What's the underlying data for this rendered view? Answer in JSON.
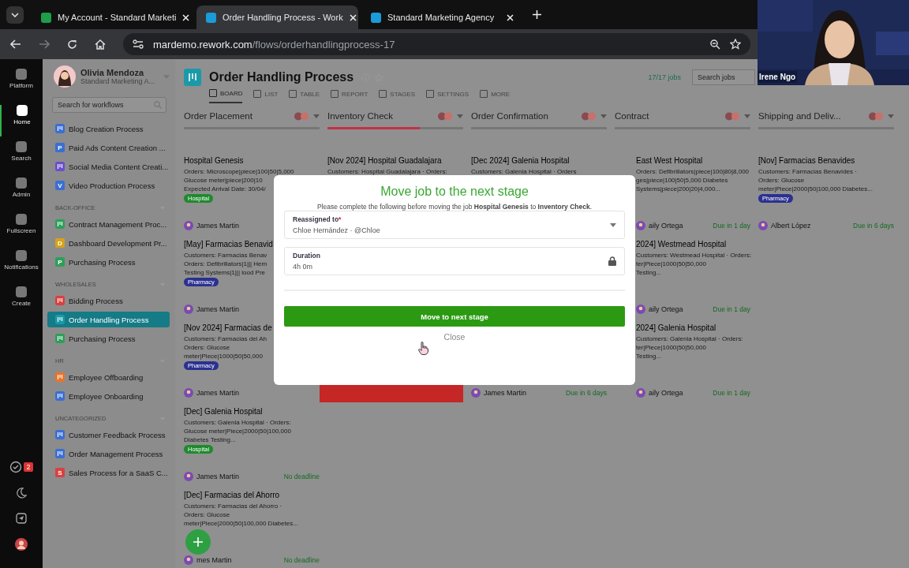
{
  "browser": {
    "tabs": [
      {
        "title": "My Account - Standard Marketi",
        "selected": false
      },
      {
        "title": "Order Handling Process - Work",
        "selected": true
      },
      {
        "title": "Standard Marketing Agency",
        "selected": false
      }
    ],
    "url": {
      "domain": "mardemo.rework.com",
      "path": "/flows/orderhandlingprocess-17"
    }
  },
  "webcam": {
    "name": "Irene Ngo"
  },
  "rail": {
    "items": [
      {
        "label": "Platform",
        "selected": false
      },
      {
        "label": "Home",
        "selected": true
      },
      {
        "label": "Search",
        "selected": false
      },
      {
        "label": "Admin",
        "selected": false
      },
      {
        "label": "Fullscreen",
        "selected": false
      },
      {
        "label": "Notifications",
        "selected": false
      },
      {
        "label": "Create",
        "selected": false
      }
    ],
    "badge": "2"
  },
  "sidebar": {
    "user": {
      "name": "Olivia Mendoza",
      "org": "Standard Marketing A..."
    },
    "search": {
      "placeholder": "Search for workflows"
    },
    "groups": [
      {
        "items": [
          {
            "label": "Blog Creation Process",
            "color": "#3b6fd1",
            "selected": false
          },
          {
            "label": "Paid Ads Content Creation ...",
            "color": "#3b6fd1",
            "initial": "P",
            "selected": false
          },
          {
            "label": "Social Media Content Creati...",
            "color": "#6a4fc9",
            "selected": false
          },
          {
            "label": "Video Production Process",
            "color": "#3b6fd1",
            "initial": "V",
            "selected": false
          }
        ]
      },
      {
        "title": "BACK-OFFICE",
        "items": [
          {
            "label": "Contract Management Proc...",
            "color": "#2e9e5a",
            "selected": false
          },
          {
            "label": "Dashboard Development Pr...",
            "color": "#d6a21a",
            "initial": "D",
            "selected": false
          },
          {
            "label": "Purchasing Process",
            "color": "#2e9e5a",
            "initial": "P",
            "selected": false
          }
        ]
      },
      {
        "title": "WHOLESALES",
        "items": [
          {
            "label": "Bidding Process",
            "color": "#d94040",
            "selected": false
          },
          {
            "label": "Order Handling Process",
            "color": "#1a9aa8",
            "selected": true
          },
          {
            "label": "Purchasing Process",
            "color": "#2e9e5a",
            "selected": false
          }
        ]
      },
      {
        "title": "HR",
        "items": [
          {
            "label": "Employee Offboarding",
            "color": "#e8742a",
            "selected": false
          },
          {
            "label": "Employee Onboarding",
            "color": "#3b6fd1",
            "selected": false
          }
        ]
      },
      {
        "title": "UNCATEGORIZED",
        "items": [
          {
            "label": "Customer Feedback Process",
            "color": "#3b6fd1",
            "selected": false
          },
          {
            "label": "Order Management Process",
            "color": "#3b6fd1",
            "selected": false
          },
          {
            "label": "Sales Process for a SaaS C...",
            "color": "#d94040",
            "initial": "S",
            "selected": false
          }
        ]
      }
    ]
  },
  "main": {
    "title": "Order Handling Process",
    "count": "17/17 jobs",
    "search": {
      "placeholder": "Search jobs"
    },
    "tabs": [
      {
        "label": "BOARD",
        "selected": true
      },
      {
        "label": "LIST",
        "selected": false
      },
      {
        "label": "TABLE",
        "selected": false
      },
      {
        "label": "REPORT",
        "selected": false
      },
      {
        "label": "STAGES",
        "selected": false
      },
      {
        "label": "SETTINGS",
        "selected": false
      },
      {
        "label": "MORE",
        "selected": false
      }
    ],
    "columns": [
      {
        "name": "Order Placement",
        "cards": [
          {
            "title": "Hospital Genesis",
            "lines": [
              "Orders: Microscope|piece|100|50|5,000",
              "Glucose meter|piece|200|10",
              "Expected Arrival Date: 30/04/"
            ],
            "tag": {
              "label": "Hospital",
              "color": "#1f8a2e"
            },
            "assignee": "James Martin"
          },
          {
            "title": "[May] Farmacias Benavid",
            "lines": [
              "Customers: Farmacias Benav",
              "Orders: Defibrillators|1||| Hem",
              "Testing Systems|1||| lood Pre"
            ],
            "tag": {
              "label": "Pharmacy",
              "color": "#2b318f"
            },
            "assignee": "James Martin"
          },
          {
            "title": "[Nov 2024] Farmacias de",
            "lines": [
              "Customers: Farmacias del Ah",
              "Orders: Glucose",
              "meter|Piece|1000|50|50,000"
            ],
            "tag": {
              "label": "Pharmacy",
              "color": "#2b318f"
            },
            "assignee": "James Martin"
          },
          {
            "title": "[Dec] Galenia Hospital",
            "lines": [
              "Customers: Galenia Hospital · Orders:",
              "Glucose meter|Piece|2000|50|100,000",
              "Diabetes Testing..."
            ],
            "tag": {
              "label": "Hospital",
              "color": "#1f8a2e"
            },
            "assignee": "James Martin",
            "due": "No deadline"
          },
          {
            "title": "[Dec] Farmacias del Ahorro",
            "lines": [
              "Customers: Farmacias del Ahorro ·",
              "Orders: Glucose",
              "meter|Piece|2000|50|100,000 Diabetes..."
            ],
            "assignee": "mes Martin",
            "due": "No deadline"
          }
        ]
      },
      {
        "name": "Inventory Check",
        "level": 0.68,
        "cards": [
          {
            "kind": "full",
            "title": "[Nov 2024] Hospital Guadalajara",
            "lines": [
              "Customers: Hospital Guadalajara · Orders:"
            ]
          },
          {
            "kind": "tail",
            "overdue": true
          }
        ]
      },
      {
        "name": "Order Confirmation",
        "cards": [
          {
            "kind": "full",
            "title": "[Dec 2024] Galenia Hospital",
            "lines": [
              "Customers: Galenia Hospital · Orders"
            ]
          },
          {
            "kind": "tail",
            "assignee": "James Martin",
            "due": "Due in 6 days"
          }
        ]
      },
      {
        "name": "Contract",
        "cards": [
          {
            "title": "East West Hospital",
            "lines": [
              "Orders: Defibrillators|piece|100|80|8,000",
              "ges|piece|100|50|5,000 Diabetes",
              "Systems|piece|200|20|4,000..."
            ],
            "assignee": "aily Ortega",
            "due": "Due in 1 day"
          },
          {
            "title": "2024] Westmead Hospital",
            "lines": [
              "Customers: Westmead Hospital · Orders:",
              "ter|Piece|1000|50|50,000",
              "Testing..."
            ],
            "assignee": "aily Ortega",
            "due": "Due in 1 day"
          },
          {
            "title": "2024] Galenia Hospital",
            "lines": [
              "Customers: Galenia Hospital · Orders:",
              "ter|Piece|1000|50|50,000",
              "Testing..."
            ],
            "assignee": "aily Ortega",
            "due": "Due in 1 day"
          }
        ]
      },
      {
        "name": "Shipping and Deliv...",
        "cards": [
          {
            "title": "[Nov] Farmacias Benavides",
            "lines": [
              "Customers: Farmacias Benavides ·",
              "Orders: Glucose",
              "meter|Piece|2000|50|100,000 Diabetes..."
            ],
            "tag": {
              "label": "Pharmacy",
              "color": "#2b318f"
            },
            "assignee": "Albert López",
            "due": "Due in 6 days"
          }
        ]
      }
    ]
  },
  "modal": {
    "title": "Move job to the next stage",
    "text": "Please complete the following before moving the job **Hospital Genesis** to **Inventory Check**.",
    "fields": [
      {
        "kind": "select",
        "label": "Reassigned to",
        "required_mark": "*",
        "value": "Chloe Hernández · @Chloe"
      },
      {
        "kind": "locked",
        "label": "Duration",
        "value": "4h 0m"
      }
    ],
    "primary": "Move to next stage",
    "secondary": "Close"
  }
}
